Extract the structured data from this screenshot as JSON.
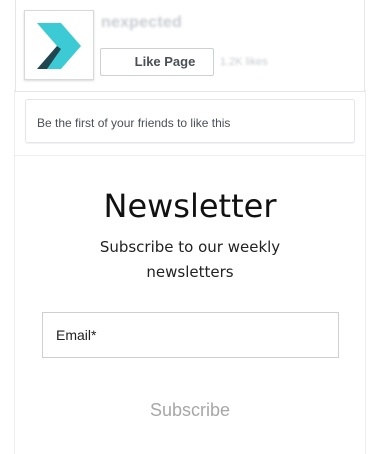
{
  "facebook_widget": {
    "page_name": "nexpected",
    "like_button_label": "Like Page",
    "likes_count": "1.2K likes",
    "friends_text": "Be the first of your friends to like this",
    "logo_icon": "chevron-logo-icon",
    "logo_colors": {
      "light": "#3ccbd4",
      "dark": "#1f3b44"
    }
  },
  "newsletter": {
    "title": "Newsletter",
    "subtitle": "Subscribe to our weekly newsletters",
    "email_placeholder": "Email*",
    "email_value": "",
    "subscribe_label": "Subscribe"
  }
}
